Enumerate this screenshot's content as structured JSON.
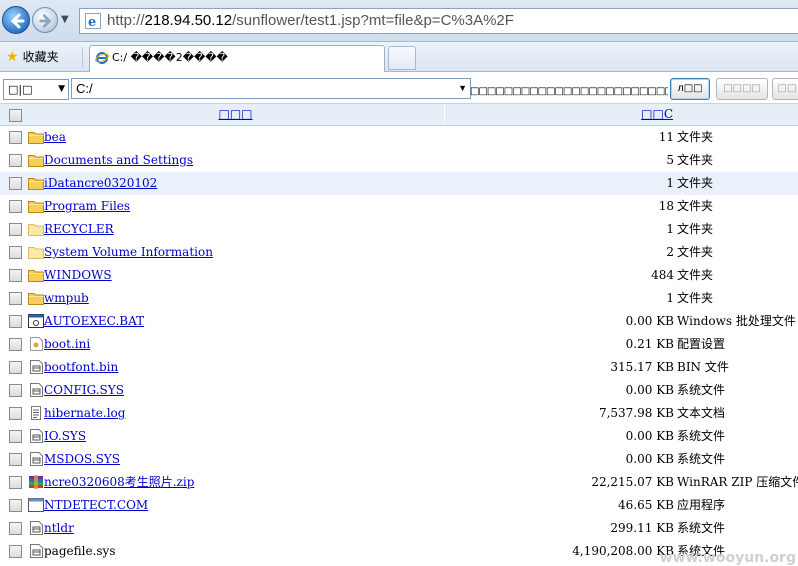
{
  "browser": {
    "url_prefix": "http://",
    "url_host": "218.94.50.12",
    "url_path": "/sunflower/test1.jsp?mt=file&p=C%3A%2F",
    "favorites_label": "收藏夹",
    "tab_title": "C:/ ����2����"
  },
  "toolbar": {
    "drive_value": "□|□",
    "path_value": "C:/",
    "garbled_text": "□□□□□□□□□□□□□□□□□□□□□□□□□□",
    "go_button": "л□□",
    "disabled_button_1": "□□□□",
    "disabled_button_2": "□□"
  },
  "table": {
    "header_name": "□□□",
    "header_size": "□□C",
    "rows": [
      {
        "name": "bea",
        "size": "11",
        "type": "文件夹",
        "icon": "folder-icon",
        "link": true,
        "alt": false
      },
      {
        "name": "Documents and Settings",
        "size": "5",
        "type": "文件夹",
        "icon": "folder-icon",
        "link": true,
        "alt": false
      },
      {
        "name": "iDatancre0320102",
        "size": "1",
        "type": "文件夹",
        "icon": "folder-icon",
        "link": true,
        "alt": true
      },
      {
        "name": "Program Files",
        "size": "18",
        "type": "文件夹",
        "icon": "folder-icon",
        "link": true,
        "alt": false
      },
      {
        "name": "RECYCLER",
        "size": "1",
        "type": "文件夹",
        "icon": "folder-hidden-icon",
        "link": true,
        "alt": false
      },
      {
        "name": "System Volume Information",
        "size": "2",
        "type": "文件夹",
        "icon": "folder-hidden-icon",
        "link": true,
        "alt": false
      },
      {
        "name": "WINDOWS",
        "size": "484",
        "type": "文件夹",
        "icon": "folder-icon",
        "link": true,
        "alt": false
      },
      {
        "name": "wmpub",
        "size": "1",
        "type": "文件夹",
        "icon": "folder-icon",
        "link": true,
        "alt": false
      },
      {
        "name": "AUTOEXEC.BAT",
        "size": "0.00 KB",
        "type": "Windows 批处理文件",
        "icon": "batch-file-icon",
        "link": true,
        "alt": false
      },
      {
        "name": "boot.ini",
        "size": "0.21 KB",
        "type": "配置设置",
        "icon": "config-file-icon",
        "link": true,
        "alt": false
      },
      {
        "name": "bootfont.bin",
        "size": "315.17 KB",
        "type": "BIN 文件",
        "icon": "system-file-icon",
        "link": true,
        "alt": false
      },
      {
        "name": "CONFIG.SYS",
        "size": "0.00 KB",
        "type": "系统文件",
        "icon": "system-file-icon",
        "link": true,
        "alt": false
      },
      {
        "name": "hibernate.log",
        "size": "7,537.98 KB",
        "type": "文本文档",
        "icon": "text-file-icon",
        "link": true,
        "alt": false
      },
      {
        "name": "IO.SYS",
        "size": "0.00 KB",
        "type": "系统文件",
        "icon": "system-file-icon",
        "link": true,
        "alt": false
      },
      {
        "name": "MSDOS.SYS",
        "size": "0.00 KB",
        "type": "系统文件",
        "icon": "system-file-icon",
        "link": true,
        "alt": false
      },
      {
        "name": "ncre0320608考生照片.zip",
        "size": "22,215.07 KB",
        "type": "WinRAR ZIP 压缩文件",
        "icon": "zip-archive-icon",
        "link": true,
        "alt": false
      },
      {
        "name": "NTDETECT.COM",
        "size": "46.65 KB",
        "type": "应用程序",
        "icon": "application-icon",
        "link": true,
        "alt": false
      },
      {
        "name": "ntldr",
        "size": "299.11 KB",
        "type": "系统文件",
        "icon": "system-file-icon",
        "link": true,
        "alt": false
      },
      {
        "name": "pagefile.sys",
        "size": "4,190,208.00 KB",
        "type": "系统文件",
        "icon": "system-file-icon",
        "link": false,
        "alt": false
      }
    ]
  },
  "watermark": "www.wooyun.org",
  "colors": {
    "link": "#0000cc",
    "header_bg": "#e6eef8",
    "alt_row_bg": "#eaf1fa",
    "folder": "#f5c842"
  }
}
